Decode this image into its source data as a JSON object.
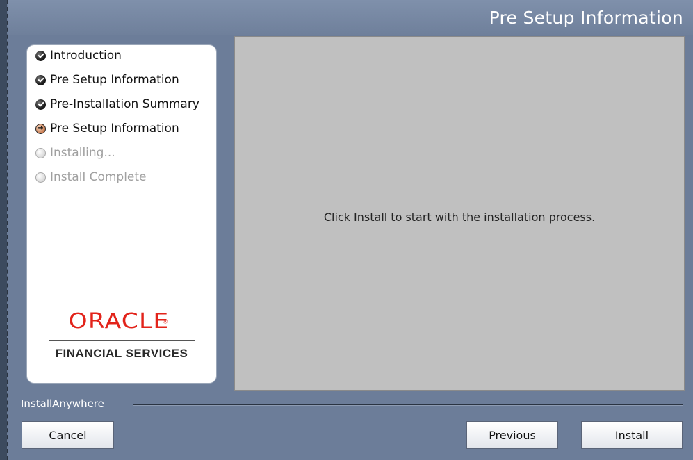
{
  "window": {
    "title": "Pre Setup Information"
  },
  "steps": [
    {
      "label": "Introduction",
      "state": "done"
    },
    {
      "label": "Pre Setup Information",
      "state": "done"
    },
    {
      "label": "Pre-Installation Summary",
      "state": "done"
    },
    {
      "label": "Pre Setup Information",
      "state": "current"
    },
    {
      "label": "Installing...",
      "state": "pending"
    },
    {
      "label": "Install Complete",
      "state": "pending"
    }
  ],
  "logo": {
    "brand": "ORACLE",
    "trademark": "®",
    "subtitle": "FINANCIAL SERVICES"
  },
  "content": {
    "message": "Click Install to start with the installation process."
  },
  "footer": {
    "installer_label": "InstallAnywhere",
    "cancel_label": "Cancel",
    "previous_label": "Previous",
    "install_label": "Install"
  },
  "colors": {
    "window_bg": "#6c7d99",
    "content_bg": "#c0c0c0",
    "oracle_red": "#e2231a"
  }
}
